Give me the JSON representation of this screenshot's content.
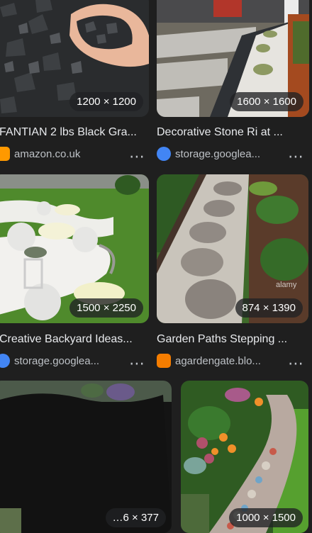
{
  "results": [
    {
      "title": "FANTIAN 2 lbs Black Gra...",
      "dims": "1200 × 1200",
      "source": "amazon.co.uk",
      "favicon": "amazon-icon"
    },
    {
      "title": "Decorative Stone Ri at ...",
      "dims": "1600 × 1600",
      "source": "storage.googlea...",
      "favicon": "google-cloud-icon"
    },
    {
      "title": "Creative Backyard Ideas...",
      "dims": "1500 × 2250",
      "source": "storage.googlea...",
      "favicon": "google-cloud-icon"
    },
    {
      "title": "Garden Paths Stepping ...",
      "dims": "874 × 1390",
      "source": "agardengate.blo...",
      "favicon": "blogger-icon"
    },
    {
      "title": "",
      "dims": "…6 × 377",
      "source": "",
      "favicon": ""
    },
    {
      "title": "",
      "dims": "1000 × 1500",
      "source": "",
      "favicon": ""
    }
  ],
  "more_label": "⋯",
  "watermark": "alamy",
  "colors": {
    "background": "#1f1f1f",
    "amazon": "#ff9900",
    "google_cloud": "#4285f4",
    "blogger": "#f57d00"
  }
}
